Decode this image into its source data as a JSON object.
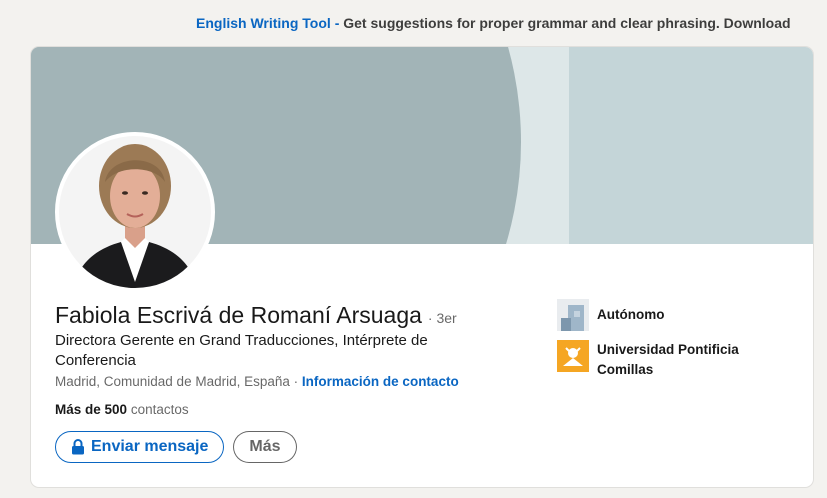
{
  "banner": {
    "link_text": "English Writing Tool -",
    "text": "Get suggestions for proper grammar and clear phrasing. Download"
  },
  "profile": {
    "name": "Fabiola Escrivá de Romaní Arsuaga",
    "degree": "· 3er",
    "headline": "Directora Gerente en Grand Traducciones, Intérprete de Conferencia",
    "location": "Madrid, Comunidad de Madrid, España",
    "separator": "·",
    "contact_info": "Información de contacto",
    "connections_count": "Más de 500",
    "connections_label": "contactos"
  },
  "actions": {
    "message": "Enviar mensaje",
    "more": "Más"
  },
  "sidebar": {
    "current_position": "Autónomo",
    "education": "Universidad Pontificia Comillas"
  },
  "colors": {
    "accent": "#0a66c2",
    "cover_primary": "#a2b4b7",
    "cover_secondary": "#c4d5d8",
    "comillas_logo": "#f5a623"
  }
}
